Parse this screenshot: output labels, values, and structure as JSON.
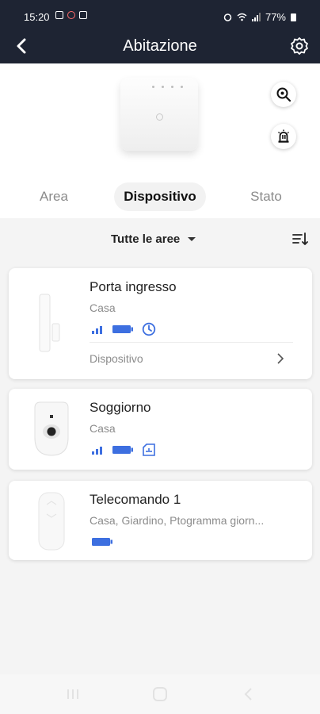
{
  "status_bar": {
    "time": "15:20",
    "battery": "77%",
    "left_icons": [
      "photo-icon",
      "clock-icon",
      "mail-icon"
    ],
    "right_icons": [
      "alarm-icon",
      "wifi-icon",
      "signal-icon",
      "battery-icon"
    ]
  },
  "header": {
    "title": "Abitazione",
    "back_icon": "back-arrow-icon",
    "settings_icon": "gear-icon",
    "background": "#1e2433"
  },
  "hero": {
    "hub_icon": "hub-device-image",
    "actions": [
      "search-device-icon",
      "alarm-siren-icon"
    ]
  },
  "tabs": [
    {
      "label": "Area",
      "active": false
    },
    {
      "label": "Dispositivo",
      "active": true
    },
    {
      "label": "Stato",
      "active": false
    }
  ],
  "filter": {
    "label": "Tutte le aree",
    "sort_icon": "sort-list-icon"
  },
  "devices": [
    {
      "name": "Porta ingresso",
      "area": "Casa",
      "status_icons": [
        "signal-icon",
        "battery-icon",
        "clock-icon"
      ],
      "footer": "Dispositivo"
    },
    {
      "name": "Soggiorno",
      "area": "Casa",
      "status_icons": [
        "signal-icon",
        "battery-icon",
        "tamper-icon"
      ]
    },
    {
      "name": "Telecomando 1",
      "area": "Casa, Giardino, Ptogramma giorn...",
      "status_icons": [
        "battery-icon"
      ]
    }
  ],
  "colors": {
    "accent": "#3d6fe0",
    "active_text": "#111111",
    "inactive_text": "#8b8b8b"
  },
  "nav_bar": [
    "recent-apps-icon",
    "home-icon",
    "back-icon"
  ]
}
